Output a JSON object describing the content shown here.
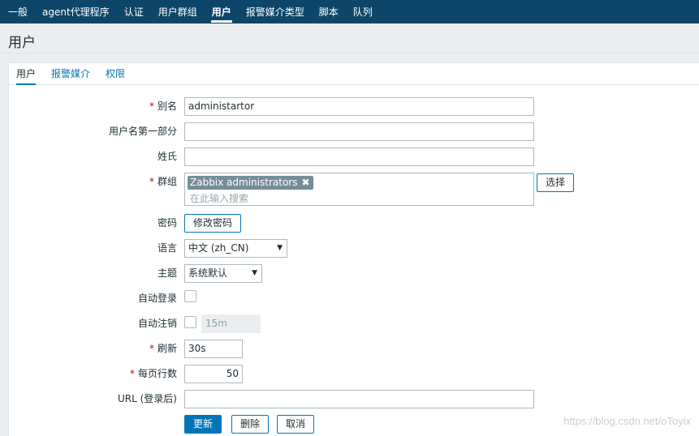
{
  "topnav": {
    "items": [
      {
        "label": "一般",
        "active": false
      },
      {
        "label": "agent代理程序",
        "active": false
      },
      {
        "label": "认证",
        "active": false
      },
      {
        "label": "用户群组",
        "active": false
      },
      {
        "label": "用户",
        "active": true
      },
      {
        "label": "报警媒介类型",
        "active": false
      },
      {
        "label": "脚本",
        "active": false
      },
      {
        "label": "队列",
        "active": false
      }
    ]
  },
  "page": {
    "title": "用户"
  },
  "tabs": [
    {
      "label": "用户",
      "active": true
    },
    {
      "label": "报警媒介",
      "active": false
    },
    {
      "label": "权限",
      "active": false
    }
  ],
  "form": {
    "alias": {
      "label": "别名",
      "required": "*",
      "value": "administartor"
    },
    "name": {
      "label": "用户名第一部分",
      "value": ""
    },
    "surname": {
      "label": "姓氏",
      "value": ""
    },
    "groups": {
      "label": "群组",
      "required": "*",
      "tag": "Zabbix administrators",
      "tag_remove": "✖",
      "search_placeholder": "在此输入搜索",
      "select_button": "选择"
    },
    "password": {
      "label": "密码",
      "button": "修改密码"
    },
    "language": {
      "label": "语言",
      "value": "中文 (zh_CN)",
      "caret": "▼"
    },
    "theme": {
      "label": "主题",
      "value": "系统默认",
      "caret": "▼"
    },
    "autologin": {
      "label": "自动登录",
      "checked": false
    },
    "autologout": {
      "label": "自动注销",
      "checked": false,
      "value": "15m"
    },
    "refresh": {
      "label": "刷新",
      "required": "*",
      "value": "30s"
    },
    "rows_per_page": {
      "label": "每页行数",
      "required": "*",
      "value": "50"
    },
    "url": {
      "label": "URL (登录后)",
      "value": ""
    }
  },
  "actions": {
    "update": "更新",
    "delete": "删除",
    "cancel": "取消"
  },
  "watermark": "https://blog.csdn.net/oToyix",
  "colors": {
    "nav_bg": "#0e4669",
    "accent": "#0275b8",
    "required": "#d40000",
    "tag_bg": "#768d99"
  }
}
